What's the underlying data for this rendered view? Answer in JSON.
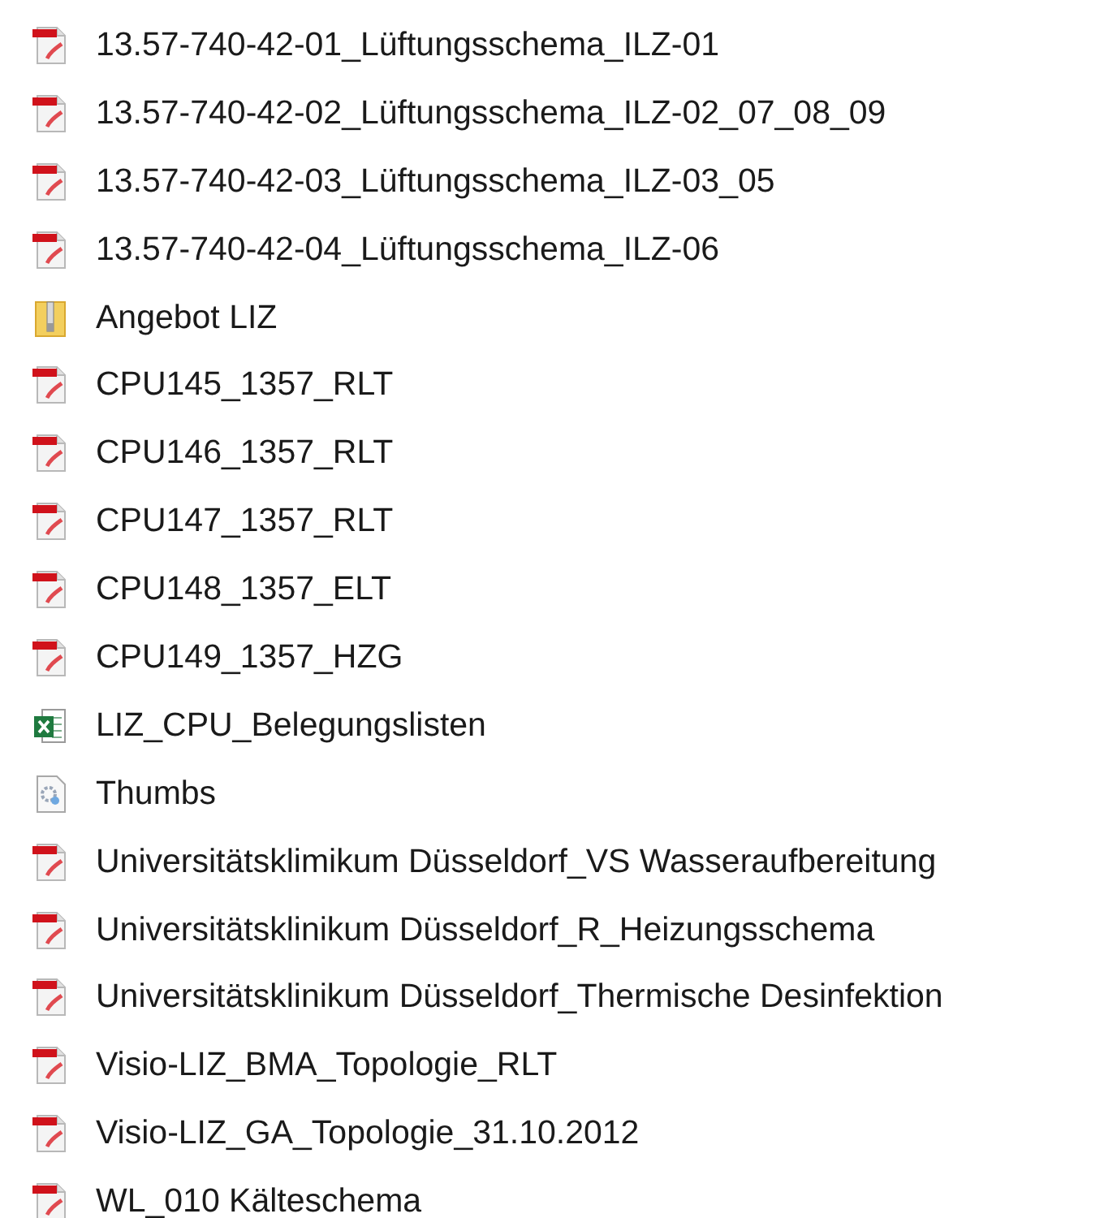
{
  "files": [
    {
      "name": "13.57-740-42-01_Lüftungsschema_ILZ-01",
      "kind": "pdf"
    },
    {
      "name": "13.57-740-42-02_Lüftungsschema_ILZ-02_07_08_09",
      "kind": "pdf"
    },
    {
      "name": "13.57-740-42-03_Lüftungsschema_ILZ-03_05",
      "kind": "pdf"
    },
    {
      "name": "13.57-740-42-04_Lüftungsschema_ILZ-06",
      "kind": "pdf"
    },
    {
      "name": "Angebot LIZ",
      "kind": "zip"
    },
    {
      "name": "CPU145_1357_RLT",
      "kind": "pdf"
    },
    {
      "name": "CPU146_1357_RLT",
      "kind": "pdf"
    },
    {
      "name": "CPU147_1357_RLT",
      "kind": "pdf"
    },
    {
      "name": "CPU148_1357_ELT",
      "kind": "pdf"
    },
    {
      "name": "CPU149_1357_HZG",
      "kind": "pdf"
    },
    {
      "name": "LIZ_CPU_Belegungslisten",
      "kind": "excel"
    },
    {
      "name": "Thumbs",
      "kind": "system"
    },
    {
      "name": "Universitätsklimikum Düsseldorf_VS Wasseraufbereitung",
      "kind": "pdf"
    },
    {
      "name": "Universitätsklinikum Düsseldorf_R_Heizungsschema",
      "kind": "pdf"
    },
    {
      "name": "Universitätsklinikum Düsseldorf_Thermische Desinfektion",
      "kind": "pdf"
    },
    {
      "name": "Visio-LIZ_BMA_Topologie_RLT",
      "kind": "pdf"
    },
    {
      "name": "Visio-LIZ_GA_Topologie_31.10.2012",
      "kind": "pdf"
    },
    {
      "name": "WL_010 Kälteschema",
      "kind": "pdf"
    }
  ]
}
